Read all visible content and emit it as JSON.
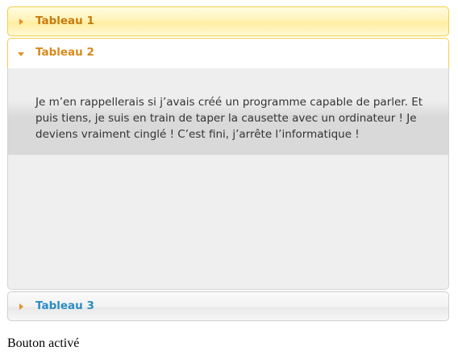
{
  "accordion": {
    "panels": [
      {
        "title": "Tableau 1",
        "state": "collapsed",
        "arrow_icon": "triangle-right-icon"
      },
      {
        "title": "Tableau 2",
        "state": "expanded",
        "arrow_icon": "triangle-down-icon",
        "content": "Je m’en rappellerais si j’avais créé un programme capable de parler. Et puis tiens, je suis en train de taper la causette avec un ordinateur ! Je deviens vraiment cinglé ! C’est fini, j’arrête l’informatique !"
      },
      {
        "title": "Tableau 3",
        "state": "collapsed",
        "arrow_icon": "triangle-right-icon"
      }
    ]
  },
  "status": {
    "text": "Bouton activé"
  },
  "colors": {
    "header_text_orange": "#c77b10",
    "header_text_blue": "#2a8cc4",
    "arrow": "#e8902a",
    "active_border": "#f0cf4a"
  }
}
